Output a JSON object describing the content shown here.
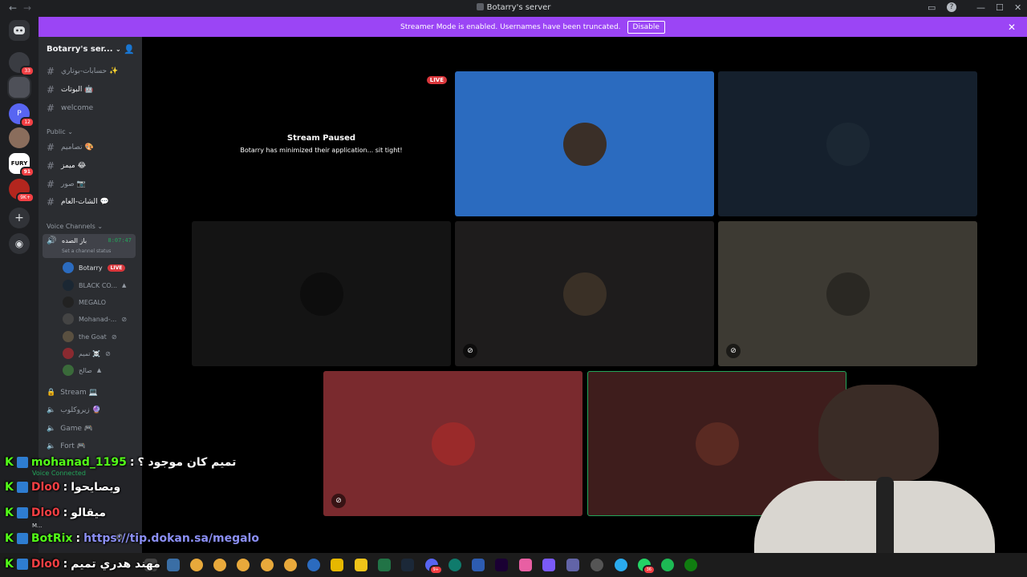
{
  "window": {
    "title": "Botarry's server"
  },
  "banner": {
    "text": "Streamer Mode is enabled. Usernames have been truncated.",
    "button": "Disable"
  },
  "rail": {
    "badges": [
      "33",
      "12",
      "91",
      "9K+"
    ],
    "fury_label": "FURY"
  },
  "sidebar": {
    "server_name": "Botarry's ser...",
    "channels_top": [
      {
        "name": "حسابات-بوتاري ✨"
      },
      {
        "name": "البوتات 🤖"
      },
      {
        "name": "welcome"
      }
    ],
    "category_public": "Public",
    "channels_public": [
      {
        "name": "تصاميم 🎨"
      },
      {
        "name": "ميمز 😂"
      },
      {
        "name": "صور 📷"
      },
      {
        "name": "الشات-العام 💬"
      }
    ],
    "category_voice": "Voice Channels",
    "voice_channel": {
      "name": "باز الصده",
      "timer": "8:07:47",
      "status": "Set a channel status"
    },
    "voice_users": [
      {
        "name": "Botarry",
        "live": "LIVE"
      },
      {
        "name": "BLACK CO..."
      },
      {
        "name": "MEGALO"
      },
      {
        "name": "Mohanad-..."
      },
      {
        "name": "the Goat"
      },
      {
        "name": "تميم ☠️"
      },
      {
        "name": "صالح"
      }
    ],
    "other_channels": [
      {
        "name": "Stream 💻"
      },
      {
        "name": "زيروكلوب 🔮"
      },
      {
        "name": "Game 🎮"
      },
      {
        "name": "Fort 🎮"
      }
    ],
    "voice_connected": "Voice Connected",
    "user_short": "M..."
  },
  "stage": {
    "live_badge": "LIVE",
    "paused_title": "Stream Paused",
    "paused_sub": "Botarry has minimized their application... sit tight!",
    "tile_colors": [
      "#2b6bbf",
      "#15202d",
      "#141414",
      "#1e1c1c",
      "#3d3a33",
      "#7a2a2e",
      "#3e1d1c"
    ]
  },
  "chat": [
    {
      "user": "mohanad_1195",
      "message": "تميم كان موجود ؟",
      "user_color": "#53fc18"
    },
    {
      "user": "Dlo0",
      "message": "ويصايحوا",
      "user_color": "#f23f43"
    },
    {
      "user": "Dlo0",
      "message": "ميقالو",
      "user_color": "#f23f43"
    },
    {
      "user": "BotRix",
      "message": "https://tip.dokan.sa/megalo",
      "user_color": "#53fc18"
    },
    {
      "user": "Dlo0",
      "message": "مهند هدري تميم",
      "user_color": "#f23f43"
    }
  ],
  "chat_separator": ":",
  "chat_badge": "K",
  "taskbar": {
    "notif_1": "9+",
    "notif_2": "36"
  }
}
